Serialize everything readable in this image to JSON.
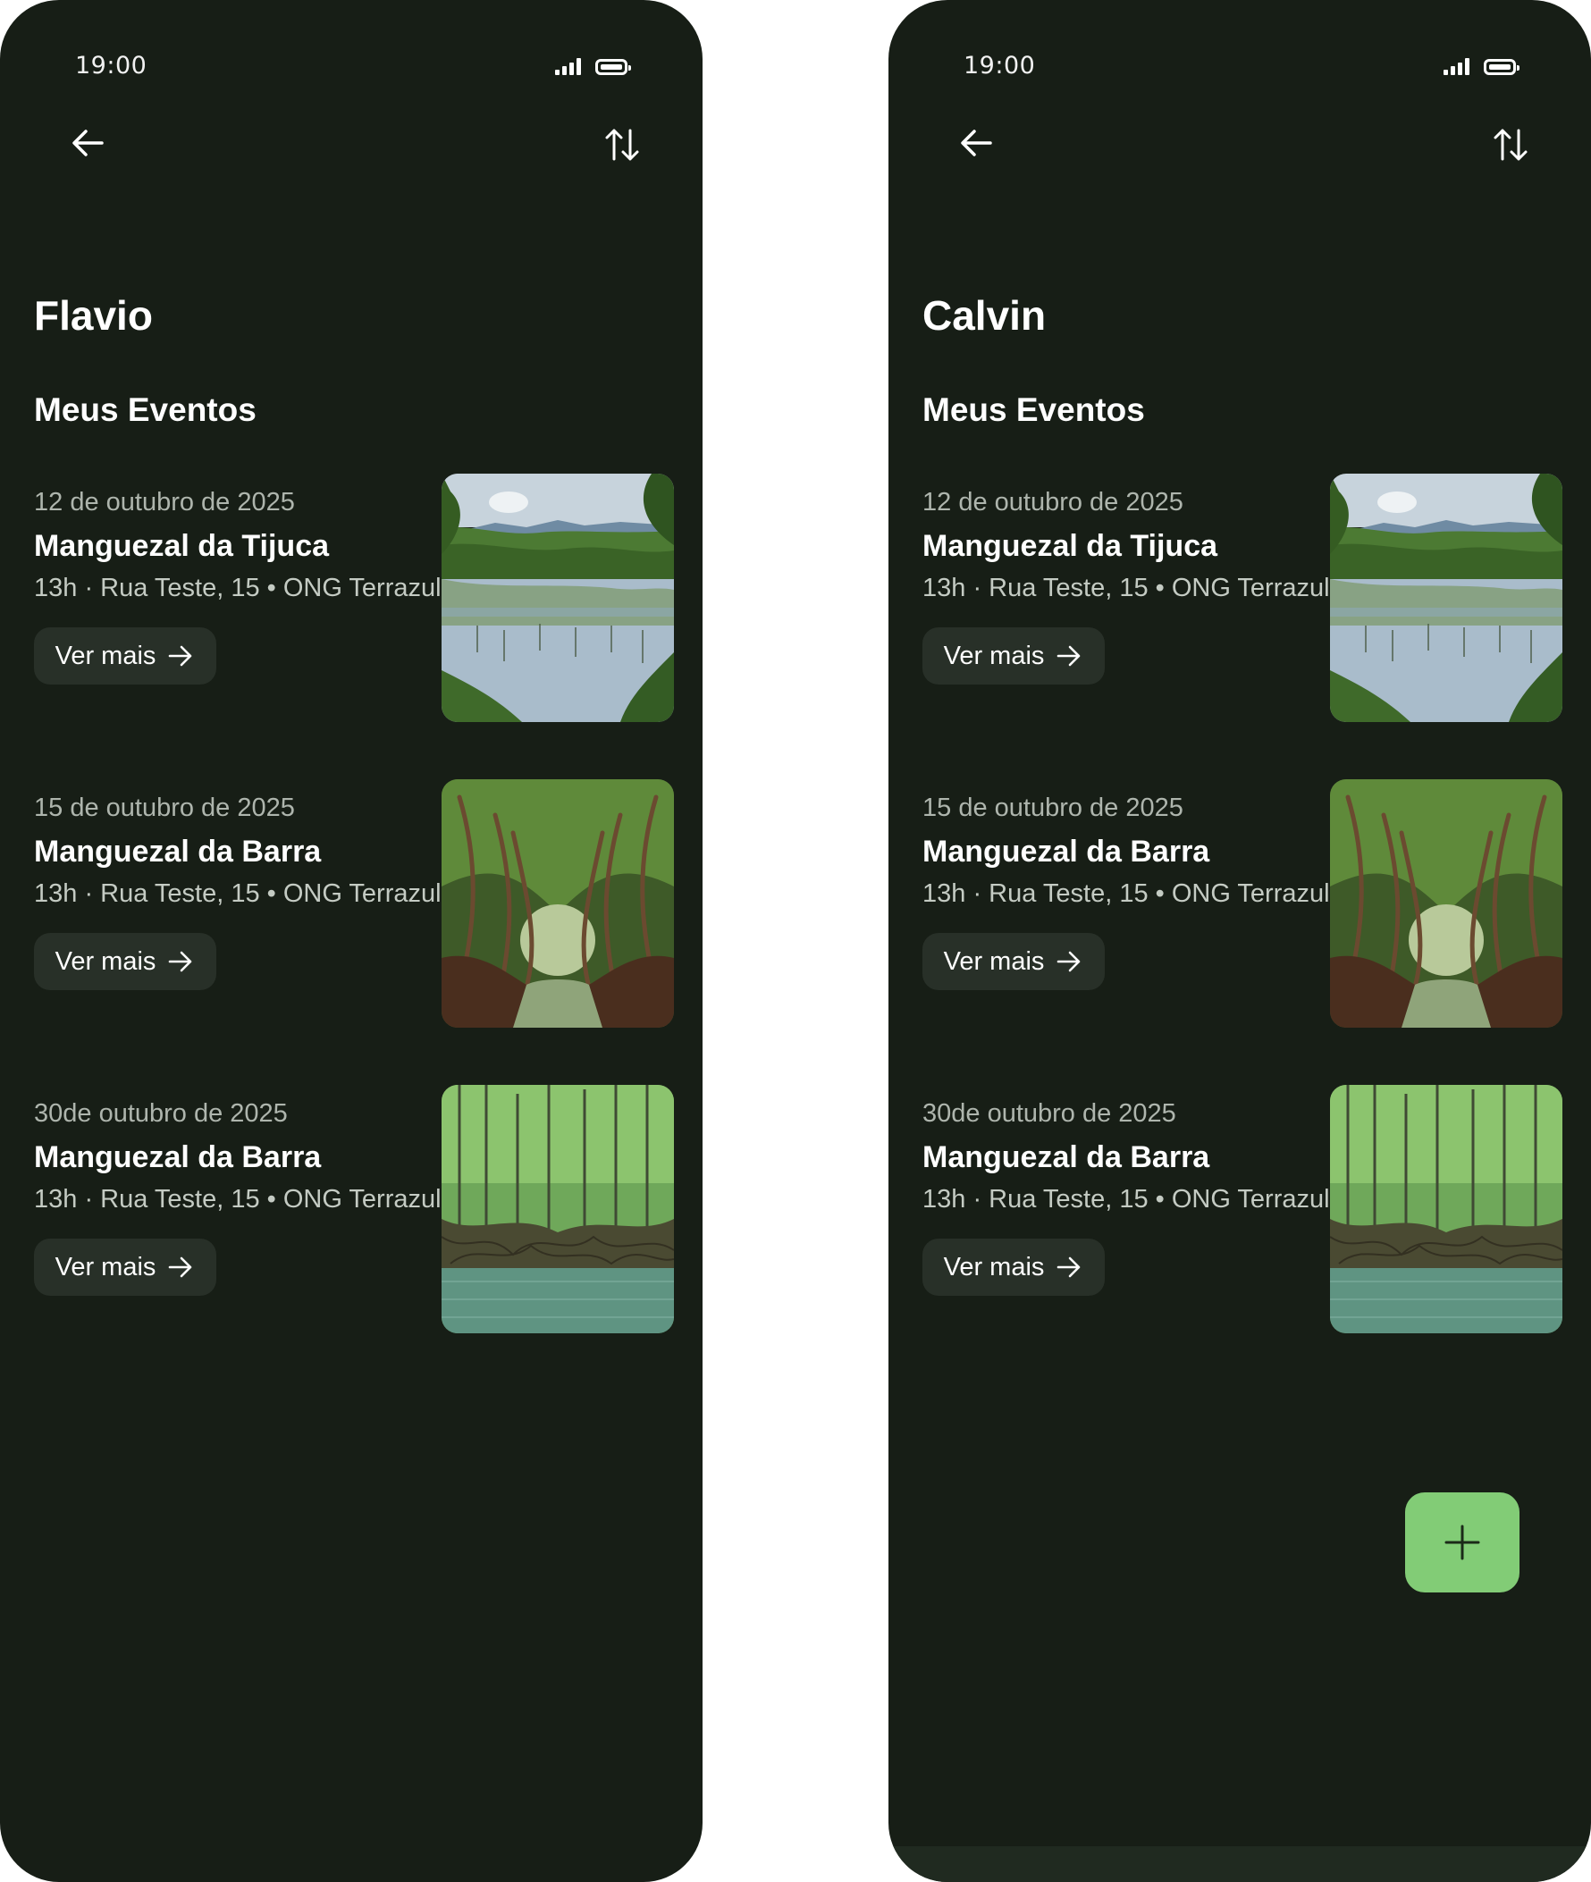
{
  "colors": {
    "background": "#171e16",
    "button": "#283028",
    "fab": "#82cc76",
    "text_primary": "#ffffff",
    "text_secondary": "#aeb5ad"
  },
  "phones": [
    {
      "status_time": "19:00",
      "user_name": "Flavio",
      "section_title": "Meus Eventos",
      "events": [
        {
          "date": "12 de outubro de 2025",
          "title": "Manguezal da Tijuca",
          "meta": "13h · Rua Teste, 15 • ONG Terrazul",
          "button": "Ver mais",
          "image": "mangrove-lagoon-photo"
        },
        {
          "date": "15 de outubro de 2025",
          "title": "Manguezal da Barra",
          "meta": "13h · Rua Teste, 15 • ONG Terrazul",
          "button": "Ver mais",
          "image": "mangrove-tunnel-photo"
        },
        {
          "date": "30de outubro de 2025",
          "title": "Manguezal da Barra",
          "meta": "13h · Rua Teste, 15 • ONG Terrazul",
          "button": "Ver mais",
          "image": "mangrove-roots-photo"
        }
      ]
    },
    {
      "status_time": "19:00",
      "user_name": "Calvin",
      "section_title": "Meus Eventos",
      "events": [
        {
          "date": "12 de outubro de 2025",
          "title": "Manguezal da Tijuca",
          "meta": "13h · Rua Teste, 15 • ONG Terrazul",
          "button": "Ver mais",
          "image": "mangrove-lagoon-photo"
        },
        {
          "date": "15 de outubro de 2025",
          "title": "Manguezal da Barra",
          "meta": "13h · Rua Teste, 15 • ONG Terrazul",
          "button": "Ver mais",
          "image": "mangrove-tunnel-photo"
        },
        {
          "date": "30de outubro de 2025",
          "title": "Manguezal da Barra",
          "meta": "13h · Rua Teste, 15 • ONG Terrazul",
          "button": "Ver mais",
          "image": "mangrove-roots-photo"
        }
      ],
      "fab_icon": "plus-icon"
    }
  ],
  "icons": {
    "back": "arrow-left-icon",
    "sort": "sort-arrows-icon",
    "signal": "signal-icon",
    "battery": "battery-icon",
    "button_arrow": "arrow-right-icon"
  }
}
